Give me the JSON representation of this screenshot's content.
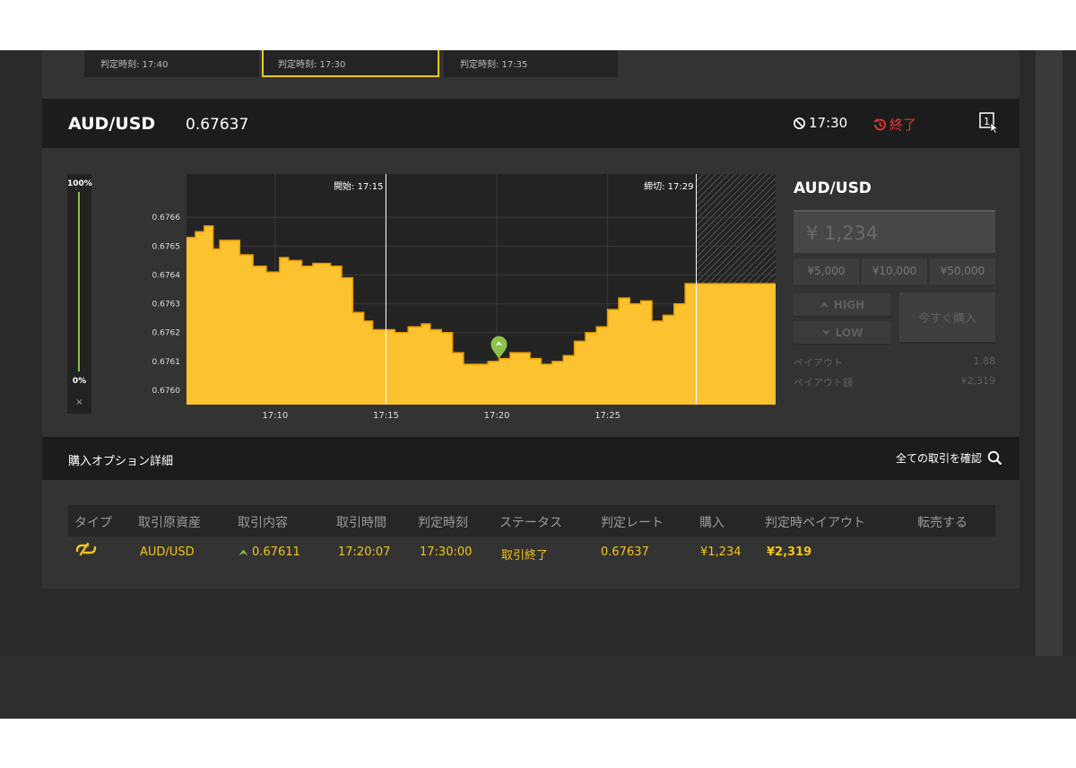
{
  "expiry_cards": [
    {
      "label": "判定時刻: 17:40"
    },
    {
      "label": "判定時刻: 17:30"
    },
    {
      "label": "判定時刻: 17:35"
    }
  ],
  "header": {
    "pair": "AUD/USD",
    "rate": "0.67637",
    "expiry_time": "17:30",
    "status": "終了",
    "oneclick_number": "1"
  },
  "gauge": {
    "top_label": "100%",
    "bottom_label": "0%",
    "close": "×",
    "level": 1.0
  },
  "chart_data": {
    "type": "area",
    "start_label": "開始: 17:15",
    "end_label": "締切: 17:29",
    "x_ticks": [
      "17:10",
      "17:15",
      "17:20",
      "17:25"
    ],
    "y_ticks": [
      "0.6766",
      "0.6765",
      "0.6764",
      "0.6763",
      "0.6762",
      "0.6761",
      "0.6760"
    ],
    "ylim": [
      0.67595,
      0.67675
    ],
    "xlim_minutes": [
      -9.0,
      19.2
    ],
    "start_minute": 0,
    "end_minute": 14,
    "entry_minute": 5.1,
    "entry_value": 0.67611,
    "x": [
      -9,
      -8.6,
      -8.2,
      -7.8,
      -7.5,
      -7.0,
      -6.6,
      -6.0,
      -5.4,
      -4.8,
      -4.4,
      -3.8,
      -3.3,
      -3.0,
      -2.5,
      -2.0,
      -1.5,
      -1.0,
      -0.6,
      -0.2,
      0,
      0.4,
      1.0,
      1.6,
      2.0,
      2.5,
      3.0,
      3.5,
      4.0,
      4.6,
      5.1,
      5.6,
      6.0,
      6.5,
      7.0,
      7.5,
      8.0,
      8.5,
      9.0,
      9.5,
      10.0,
      10.5,
      11.0,
      11.5,
      12.0,
      12.5,
      13.0,
      13.5,
      14.0,
      14.5,
      15.0
    ],
    "y": [
      0.67653,
      0.67655,
      0.67657,
      0.67649,
      0.67652,
      0.67652,
      0.67647,
      0.67643,
      0.67641,
      0.67646,
      0.67645,
      0.67643,
      0.67644,
      0.67644,
      0.67643,
      0.67639,
      0.67627,
      0.67624,
      0.67621,
      0.67621,
      0.67621,
      0.6762,
      0.67622,
      0.67623,
      0.67621,
      0.6762,
      0.67613,
      0.67609,
      0.67609,
      0.6761,
      0.67611,
      0.67613,
      0.67613,
      0.67611,
      0.67609,
      0.6761,
      0.67612,
      0.67617,
      0.6762,
      0.67622,
      0.67628,
      0.67632,
      0.6763,
      0.67631,
      0.67624,
      0.67626,
      0.6763,
      0.67637,
      0.67637,
      0.67637,
      0.67637
    ],
    "colors": {
      "area": "#fdc22f",
      "edge": "#e89a00",
      "entry_marker": "#8bc34a"
    }
  },
  "trade_panel": {
    "pair": "AUD/USD",
    "amount": "¥ 1,234",
    "chips": [
      "¥5,000",
      "¥10,000",
      "¥50,000"
    ],
    "high_label": "HIGH",
    "low_label": "LOW",
    "buy_now": "今すぐ購入",
    "payout_label": "ペイアウト",
    "payout_value": "1.88",
    "payout_amount_label": "ペイアウト額",
    "payout_amount_value": "¥2,319"
  },
  "details": {
    "title": "購入オプション詳細",
    "view_all": "全ての取引を確認"
  },
  "table": {
    "headers": [
      "タイプ",
      "取引原資産",
      "取引内容",
      "取引時間",
      "判定時刻",
      "ステータス",
      "判定レート",
      "購入",
      "判定時ペイアウト",
      "転売する"
    ],
    "row": {
      "asset": "AUD/USD",
      "content": "0.67611",
      "trade_time": "17:20:07",
      "expiry": "17:30:00",
      "status": "取引終了",
      "expiry_rate": "0.67637",
      "purchase": "¥1,234",
      "payout": "¥2,319"
    }
  },
  "colors": {
    "accent": "#f5c518",
    "alert": "#e53935",
    "high": "#8bc34a"
  }
}
